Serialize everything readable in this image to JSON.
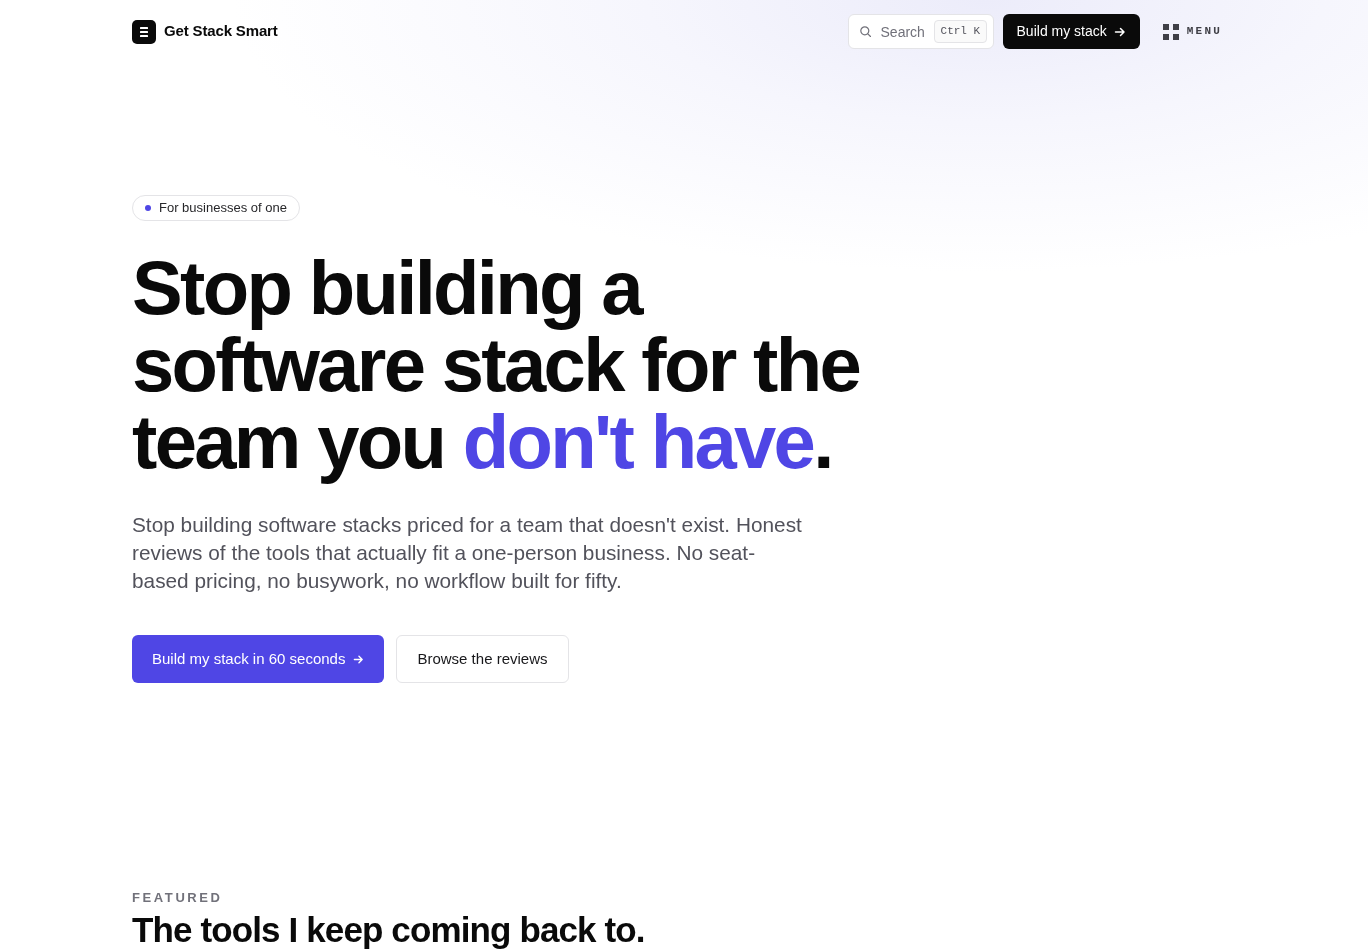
{
  "header": {
    "brand": "Get Stack Smart",
    "search": {
      "placeholder": "Search",
      "shortcut": "Ctrl K"
    },
    "cta": {
      "label": "Build my stack"
    },
    "menu": {
      "label": "MENU"
    }
  },
  "hero": {
    "badge": "For businesses of one",
    "headline": [
      {
        "text": "Stop building a software stack for the team you ",
        "kind": "plain"
      },
      {
        "text": "don't have",
        "kind": "accent"
      },
      {
        "text": ".",
        "kind": "plain"
      }
    ],
    "intro": "Stop building software stacks priced for a team that doesn't exist. Honest reviews of the tools that actually fit a one-person business. No seat-based pricing, no busywork, no workflow built for fifty.",
    "actions": [
      {
        "label": "Build my stack in 60 seconds",
        "kind": "primary"
      },
      {
        "label": "Browse the reviews",
        "kind": "secondary"
      }
    ]
  },
  "featured": {
    "eyebrow": "FEATURED",
    "title": "The tools I keep coming back to."
  }
}
